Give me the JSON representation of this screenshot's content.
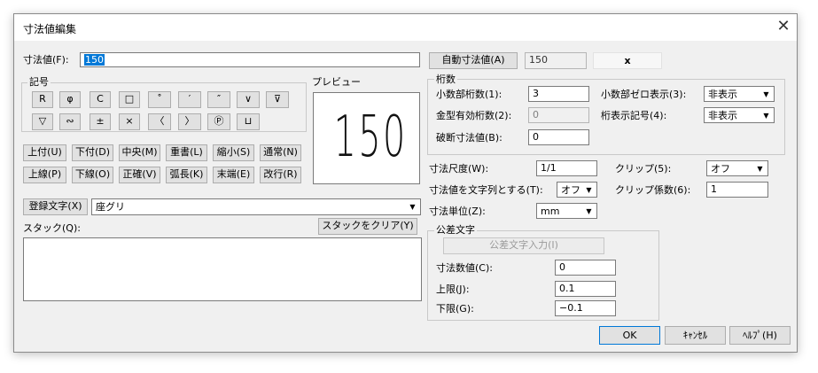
{
  "window": {
    "title": "寸法値編集",
    "close_symbol": "✕"
  },
  "dim_value": {
    "label": "寸法値(F):",
    "value": "150"
  },
  "auto_dim": {
    "button": "自動寸法値(A)",
    "value": "150",
    "x_label": "x"
  },
  "symbols": {
    "group_title": "記号",
    "row1": [
      "R",
      "φ",
      "C",
      "□",
      "˚",
      "′",
      "″",
      "∨",
      "⊽"
    ],
    "row2": [
      "▽",
      "∾",
      "±",
      "×",
      "〈",
      "〉",
      "Ⓟ",
      "⊔"
    ]
  },
  "preview": {
    "title": "プレビュー",
    "text": "150"
  },
  "position_buttons": {
    "row1": [
      "上付(U)",
      "下付(D)",
      "中央(M)",
      "重書(L)",
      "縮小(S)",
      "通常(N)"
    ],
    "row2": [
      "上線(P)",
      "下線(O)",
      "正確(V)",
      "弧長(K)",
      "末端(E)",
      "改行(R)"
    ]
  },
  "registered": {
    "button": "登録文字(X)",
    "value": "座グリ"
  },
  "stack": {
    "label": "スタック(Q):",
    "clear_button": "スタックをクリア(Y)"
  },
  "digits": {
    "group_title": "桁数",
    "decimal_label": "小数部桁数(1):",
    "decimal_value": "3",
    "mold_label": "金型有効桁数(2):",
    "mold_value": "0",
    "break_label": "破断寸法値(B):",
    "break_value": "0",
    "zero_label": "小数部ゼロ表示(3):",
    "zero_value": "非表示",
    "digit_symbol_label": "桁表示記号(4):",
    "digit_symbol_value": "非表示"
  },
  "scale": {
    "label": "寸法尺度(W):",
    "value": "1/1"
  },
  "as_string": {
    "label": "寸法値を文字列とする(T):",
    "value": "オフ"
  },
  "unit": {
    "label": "寸法単位(Z):",
    "value": "mm"
  },
  "clip": {
    "label": "クリップ(5):",
    "value": "オフ",
    "coef_label": "クリップ係数(6):",
    "coef_value": "1"
  },
  "tolerance": {
    "group_title": "公差文字",
    "input_button": "公差文字入力(I)",
    "value_label": "寸法数値(C):",
    "value": "0",
    "upper_label": "上限(J):",
    "upper": "0.1",
    "lower_label": "下限(G):",
    "lower": "−0.1"
  },
  "footer": {
    "ok": "OK",
    "cancel": "ｷｬﾝｾﾙ",
    "help": "ﾍﾙﾌﾟ(H)"
  }
}
